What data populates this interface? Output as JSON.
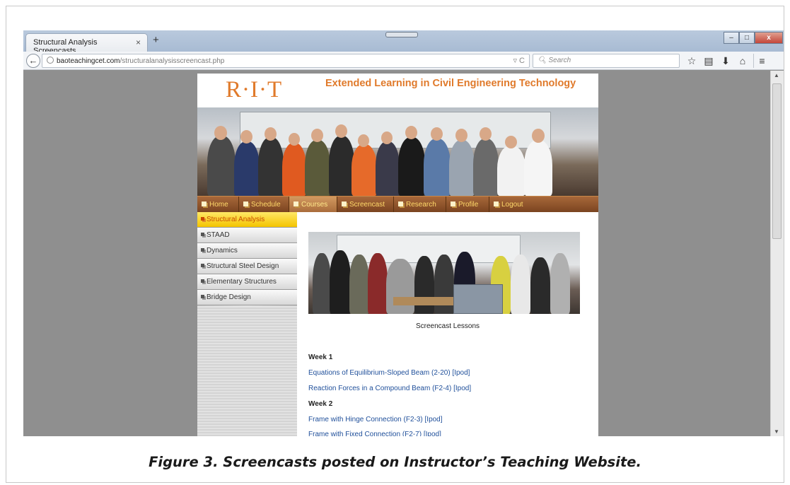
{
  "browser": {
    "tab_title": "Structural Analysis Screencasts",
    "tab_close": "×",
    "new_tab": "+",
    "url_domain": "baoteachingcet.com",
    "url_path": "/structuralanalysisscreencast.php",
    "url_tail": "▿ C",
    "search_placeholder": "Search",
    "window_buttons": [
      "–",
      "□",
      "x"
    ]
  },
  "site": {
    "logo": "R·I·T",
    "title": "Extended Learning in Civil Engineering Technology"
  },
  "topnav": [
    {
      "label": "Home"
    },
    {
      "label": "Schedule"
    },
    {
      "label": "Courses"
    },
    {
      "label": "Screencast"
    },
    {
      "label": "Research"
    },
    {
      "label": "Profile"
    },
    {
      "label": "Logout"
    }
  ],
  "sidebar": [
    {
      "label": "Structural Analysis"
    },
    {
      "label": "STAAD"
    },
    {
      "label": "Dynamics"
    },
    {
      "label": "Structural Steel Design"
    },
    {
      "label": "Elementary Structures"
    },
    {
      "label": "Bridge Design"
    }
  ],
  "main": {
    "caption": "Screencast Lessons",
    "week1": "Week 1",
    "week2": "Week 2",
    "lessons": [
      "Equations of Equilibrium-Sloped Beam (2-20) [Ipod]",
      "Reaction Forces in a Compound Beam (F2-4) [Ipod]",
      "Frame with Hinge Connection (F2-3) [Ipod]",
      "Frame with Fixed Connection (F2-7) [Ipod]"
    ]
  },
  "figure_caption": "Figure 3. Screencasts posted on Instructor’s Teaching Website."
}
